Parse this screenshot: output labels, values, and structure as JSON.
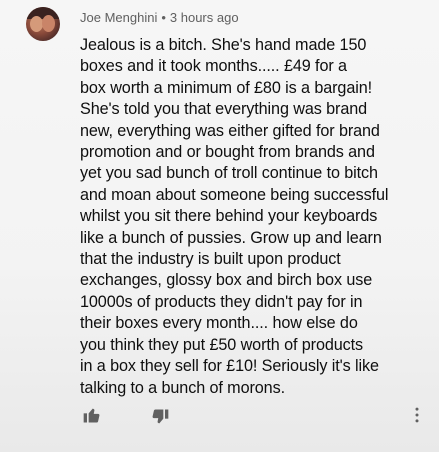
{
  "comment": {
    "author": "Joe Menghini",
    "separator": "•",
    "timestamp": "3 hours ago",
    "lines": [
      "Jealous is a bitch. She's hand made 150",
      "boxes and it took months..... £49 for a",
      "box worth a minimum of £80 is a bargain!",
      "She's told you that everything was brand",
      "new, everything was either gifted for brand",
      "promotion and or bought from brands and",
      "yet you sad bunch of troll continue to bitch",
      "and moan about someone being successful",
      "whilst you sit there behind your keyboards",
      "like a bunch of pussies. Grow up and learn",
      "that the industry is built upon product",
      "exchanges, glossy box and birch box use",
      "10000s of products they didn't pay for in",
      "their boxes every month.... how else do",
      "you think they put £50 worth of products",
      "in a box they sell for £10! Seriously it's like",
      "talking to a bunch of morons."
    ]
  },
  "actions": {
    "like_icon": "thumbs-up-icon",
    "dislike_icon": "thumbs-down-icon",
    "more_icon": "more-vertical-icon"
  },
  "colors": {
    "text": "#0f0f0f",
    "meta": "#606060",
    "icon": "#606060",
    "background": "#f4f4f4"
  }
}
